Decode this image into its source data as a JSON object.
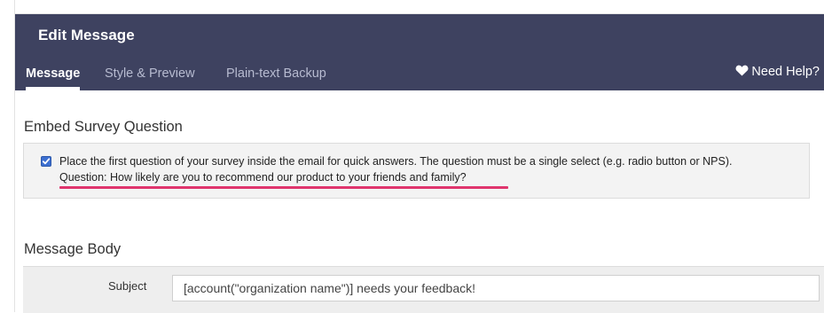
{
  "dialog": {
    "title": "Edit Message",
    "tabs": [
      {
        "label": "Message",
        "active": true
      },
      {
        "label": "Style & Preview",
        "active": false
      },
      {
        "label": "Plain-text Backup",
        "active": false
      }
    ],
    "help_label": "Need Help?"
  },
  "embed": {
    "section_title": "Embed Survey Question",
    "checked": true,
    "description": "Place the first question of your survey inside the email for quick answers. The question must be a single select (e.g. radio button or NPS).",
    "question": "Question: How likely are you to recommend our product to your friends and family?"
  },
  "message_body": {
    "section_title": "Message Body",
    "subject_label": "Subject",
    "subject_value": "[account(\"organization name\")] needs your feedback!"
  },
  "colors": {
    "header_bg": "#3e4260",
    "checkbox_accent": "#3c6fd1",
    "highlight_underline": "#e0356d"
  }
}
